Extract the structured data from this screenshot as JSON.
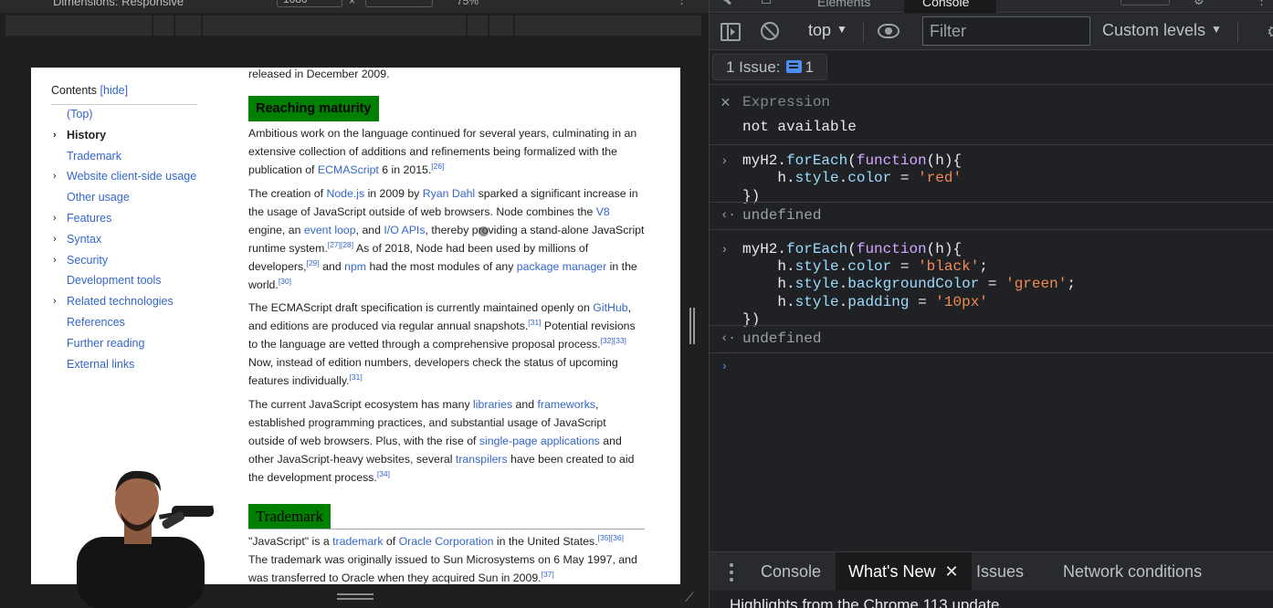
{
  "device_toolbar": {
    "dimensions_label": "Dimensions: Responsive",
    "width_value": "1080",
    "height_value": "",
    "times": "×",
    "zoom": "75%"
  },
  "wiki": {
    "toc": {
      "title": "Contents",
      "hide_label": "[hide]",
      "items": [
        {
          "label": "(Top)",
          "has_chevron": false,
          "active": false
        },
        {
          "label": "History",
          "has_chevron": true,
          "active": true
        },
        {
          "label": "Trademark",
          "has_chevron": false,
          "active": false
        },
        {
          "label": "Website client-side usage",
          "has_chevron": true,
          "active": false
        },
        {
          "label": "Other usage",
          "has_chevron": false,
          "active": false
        },
        {
          "label": "Features",
          "has_chevron": true,
          "active": false
        },
        {
          "label": "Syntax",
          "has_chevron": true,
          "active": false
        },
        {
          "label": "Security",
          "has_chevron": true,
          "active": false
        },
        {
          "label": "Development tools",
          "has_chevron": false,
          "active": false
        },
        {
          "label": "Related technologies",
          "has_chevron": true,
          "active": false
        },
        {
          "label": "References",
          "has_chevron": false,
          "active": false
        },
        {
          "label": "Further reading",
          "has_chevron": false,
          "active": false
        },
        {
          "label": "External links",
          "has_chevron": false,
          "active": false
        }
      ]
    },
    "article": {
      "lead_line": "released in December 2009.",
      "heading_maturity": "Reaching maturity",
      "p1": {
        "t1": "Ambitious work on the language continued for several years, culminating in an extensive collection of additions and refinements being formalized with the publication of ",
        "link1": "ECMAScript",
        "t2": " 6 in 2015.",
        "ref1": "[26]"
      },
      "p2": {
        "t1": "The creation of ",
        "link_node": "Node.js",
        "t2": " in 2009 by ",
        "link_dahl": "Ryan Dahl",
        "t3": " sparked a significant increase in the usage of JavaScript outside of web browsers. Node combines the ",
        "link_v8": "V8",
        "t4": " engine, an ",
        "link_event": "event loop",
        "t5": ", and ",
        "link_io": "I/O APIs",
        "t6": ", thereby providing a stand-alone JavaScript runtime system.",
        "ref1": "[27][28]",
        "t7": " As of 2018, Node had been used by millions of developers,",
        "ref2": "[29]",
        "t8": " and ",
        "link_npm": "npm",
        "t9": " had the most modules of any ",
        "link_pm": "package manager",
        "t10": " in the world.",
        "ref3": "[30]"
      },
      "p3": {
        "t1": "The ECMAScript draft specification is currently maintained openly on ",
        "link_gh": "GitHub",
        "t2": ", and editions are produced via regular annual snapshots.",
        "ref1": "[31]",
        "t3": " Potential revisions to the language are vetted through a comprehensive proposal process.",
        "ref2": "[32][33]",
        "t4": " Now, instead of edition numbers, developers check the status of upcoming features individually.",
        "ref3": "[31]"
      },
      "p4": {
        "t1": "The current JavaScript ecosystem has many ",
        "link_lib": "libraries",
        "t2": " and ",
        "link_fw": "frameworks",
        "t3": ", established programming practices, and substantial usage of JavaScript outside of web browsers. Plus, with the rise of ",
        "link_spa": "single-page applications",
        "t4": " and other JavaScript-heavy websites, several ",
        "link_tr": "transpilers",
        "t5": " have been created to aid the development process.",
        "ref1": "[34]"
      },
      "heading_trademark": "Trademark",
      "p5": {
        "t1": "\"JavaScript\" is a ",
        "link_tm": "trademark",
        "t2": " of ",
        "link_oc": "Oracle Corporation",
        "t3": " in the United States.",
        "ref1": "[35][36]",
        "t4": " The trademark was originally issued to Sun Microsystems on 6 May 1997, and was transferred to Oracle when they acquired Sun in 2009.",
        "ref2": "[37]"
      }
    }
  },
  "devtools": {
    "tabs": {
      "elements": "Elements",
      "console": "Console"
    },
    "toolbar": {
      "context": "top",
      "filter_placeholder": "Filter",
      "levels": "Custom levels"
    },
    "issues": {
      "label": "1 Issue:",
      "count": "1"
    },
    "console": {
      "expression_label": "Expression",
      "expression_value": "not available",
      "entries": [
        {
          "input": [
            {
              "parts": [
                [
                  "fnname",
                  "myH2"
                ],
                [
                  "punc",
                  "."
                ],
                [
                  "prop",
                  "forEach"
                ],
                [
                  "punc",
                  "("
                ],
                [
                  "kw",
                  "function"
                ],
                [
                  "punc",
                  "(h){"
                ]
              ]
            },
            {
              "parts": [
                [
                  "punc",
                  "    h"
                ],
                [
                  "punc",
                  "."
                ],
                [
                  "prop",
                  "style"
                ],
                [
                  "punc",
                  "."
                ],
                [
                  "prop",
                  "color"
                ],
                [
                  "punc",
                  " = "
                ],
                [
                  "str",
                  "'red'"
                ]
              ]
            },
            {
              "parts": [
                [
                  "punc",
                  "})"
                ]
              ]
            }
          ],
          "result": "undefined"
        },
        {
          "input": [
            {
              "parts": [
                [
                  "fnname",
                  "myH2"
                ],
                [
                  "punc",
                  "."
                ],
                [
                  "prop",
                  "forEach"
                ],
                [
                  "punc",
                  "("
                ],
                [
                  "kw",
                  "function"
                ],
                [
                  "punc",
                  "(h){"
                ]
              ]
            },
            {
              "parts": [
                [
                  "punc",
                  "    h"
                ],
                [
                  "punc",
                  "."
                ],
                [
                  "prop",
                  "style"
                ],
                [
                  "punc",
                  "."
                ],
                [
                  "prop",
                  "color"
                ],
                [
                  "punc",
                  " = "
                ],
                [
                  "str",
                  "'black'"
                ],
                [
                  "punc",
                  ";"
                ]
              ]
            },
            {
              "parts": [
                [
                  "punc",
                  "    h"
                ],
                [
                  "punc",
                  "."
                ],
                [
                  "prop",
                  "style"
                ],
                [
                  "punc",
                  "."
                ],
                [
                  "prop",
                  "backgroundColor"
                ],
                [
                  "punc",
                  " = "
                ],
                [
                  "str",
                  "'green'"
                ],
                [
                  "punc",
                  ";"
                ]
              ]
            },
            {
              "parts": [
                [
                  "punc",
                  "    h"
                ],
                [
                  "punc",
                  "."
                ],
                [
                  "prop",
                  "style"
                ],
                [
                  "punc",
                  "."
                ],
                [
                  "prop",
                  "padding"
                ],
                [
                  "punc",
                  " = "
                ],
                [
                  "str",
                  "'10px'"
                ]
              ]
            },
            {
              "parts": [
                [
                  "punc",
                  "})"
                ]
              ]
            }
          ],
          "result": "undefined"
        }
      ]
    },
    "drawer": {
      "tabs": [
        "Console",
        "What's New",
        "Issues",
        "Network conditions"
      ],
      "active_tab": "What's New",
      "headline": "Highlights from the Chrome 113 update"
    }
  },
  "colors": {
    "heading_bg": "#008000",
    "link": "#3366cc",
    "devtools_bg": "#202124",
    "string": "#f28b54",
    "keyword": "#d2a8ff",
    "property": "#9cdcfe"
  }
}
